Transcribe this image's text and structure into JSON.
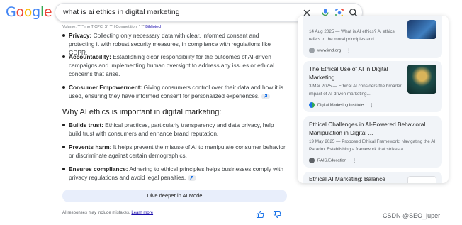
{
  "logo": {
    "letters": [
      "G",
      "o",
      "o",
      "g",
      "l",
      "e"
    ],
    "colors": [
      "#4285F4",
      "#EA4335",
      "#FBBC05",
      "#4285F4",
      "#34A853",
      "#EA4335"
    ]
  },
  "search": {
    "query": "what is ai ethics in digital marketing"
  },
  "meta_line": {
    "text": "Volume: ****|mo T CPC: $* ** | Competition: * **",
    "link": "Bibliotech"
  },
  "privacy_list": [
    {
      "title": "Privacy:",
      "text": " Collecting only necessary data with clear, informed consent and protecting it with robust security measures, in compliance with regulations like GDPR."
    },
    {
      "title": "Accountability:",
      "text": " Establishing clear responsibility for the outcomes of AI-driven campaigns and implementing human oversight to address any issues or ethical concerns that arise."
    },
    {
      "title": "Consumer Empowerment:",
      "text": " Giving consumers control over their data and how it is used, ensuring they have informed consent for personalized experiences."
    }
  ],
  "section_heading": "Why AI ethics is important in digital marketing:",
  "why_list": [
    {
      "title": "Builds trust:",
      "text": " Ethical practices, particularly transparency and data privacy, help build trust with consumers and enhance brand reputation."
    },
    {
      "title": "Prevents harm:",
      "text": " It helps prevent the misuse of AI to manipulate consumer behavior or discriminate against certain demographics."
    },
    {
      "title": "Ensures compliance:",
      "text": " Adhering to ethical principles helps businesses comply with privacy regulations and avoid legal penalties."
    }
  ],
  "deeper_button": "Dive deeper in AI Mode",
  "disclaimer": {
    "text": "AI responses may include mistakes. ",
    "link": "Learn more"
  },
  "cards": [
    {
      "title": "",
      "snippet": "14 Aug 2025 — What is AI ethics? AI ethics refers to the moral principles and...",
      "source": "www.imd.org",
      "fav_color": "#9aa0a6"
    },
    {
      "title": "The Ethical Use of AI in Digital Marketing",
      "snippet": "3 Mar 2025 — Ethical AI considers the broader impact of AI-driven marketing...",
      "source": "Digital Marketing Institute",
      "fav_color": "#34A853"
    },
    {
      "title": "Ethical Challenges in AI-Powered Behavioral Manipulation in Digital ...",
      "snippet": "19 May 2025 — Proposed Ethical Framework: Navigating the AI Paradox Establishing a framework that strikes a...",
      "source": "RAIS.Education",
      "fav_color": "#5f6368"
    },
    {
      "title": "Ethical AI Marketing: Balance",
      "snippet": "",
      "source": "",
      "fav_color": "#9aa0a6"
    }
  ],
  "kebab": "⋮",
  "watermark": "CSDN @SEO_juper"
}
